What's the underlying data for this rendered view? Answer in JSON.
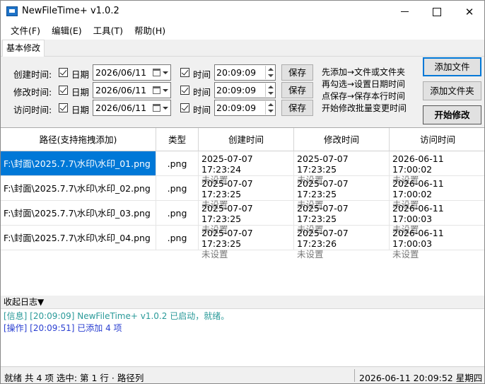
{
  "window": {
    "title": "NewFileTime+ v1.0.2"
  },
  "menu": [
    "文件(F)",
    "编辑(E)",
    "工具(T)",
    "帮助(H)"
  ],
  "tab": "基本修改",
  "rows": [
    {
      "label": "创建时间:",
      "date_check": "日期",
      "date": "2026/06/11",
      "time_check": "时间",
      "time": "20:09:09",
      "save": "保存"
    },
    {
      "label": "修改时间:",
      "date_check": "日期",
      "date": "2026/06/11",
      "time_check": "时间",
      "time": "20:09:09",
      "save": "保存"
    },
    {
      "label": "访问时间:",
      "date_check": "日期",
      "date": "2026/06/11",
      "time_check": "时间",
      "time": "20:09:09",
      "save": "保存"
    }
  ],
  "help": [
    "先添加→文件或文件夹",
    "再勾选→设置日期时间",
    "点保存→保存本行时间",
    "开始修改批量变更时间"
  ],
  "buttons": {
    "add_file": "添加文件",
    "add_folder": "添加文件夹",
    "start": "开始修改"
  },
  "table": {
    "headers": [
      "路径(支持拖拽添加)",
      "类型",
      "创建时间",
      "修改时间",
      "访问时间"
    ],
    "rows": [
      {
        "path": "F:\\封面\\2025.7.7\\水印\\水印_01.png",
        "type": ".png",
        "created": "2025-07-07 17:23:24",
        "created_new": "未设置",
        "modified": "2025-07-07 17:23:25",
        "modified_new": "未设置",
        "accessed": "2026-06-11 17:00:02",
        "accessed_new": "未设置"
      },
      {
        "path": "F:\\封面\\2025.7.7\\水印\\水印_02.png",
        "type": ".png",
        "created": "2025-07-07 17:23:25",
        "created_new": "未设置",
        "modified": "2025-07-07 17:23:25",
        "modified_new": "未设置",
        "accessed": "2026-06-11 17:00:02",
        "accessed_new": "未设置"
      },
      {
        "path": "F:\\封面\\2025.7.7\\水印\\水印_03.png",
        "type": ".png",
        "created": "2025-07-07 17:23:25",
        "created_new": "未设置",
        "modified": "2025-07-07 17:23:25",
        "modified_new": "未设置",
        "accessed": "2026-06-11 17:00:03",
        "accessed_new": "未设置"
      },
      {
        "path": "F:\\封面\\2025.7.7\\水印\\水印_04.png",
        "type": ".png",
        "created": "2025-07-07 17:23:25",
        "created_new": "未设置",
        "modified": "2025-07-07 17:23:26",
        "modified_new": "未设置",
        "accessed": "2026-06-11 17:00:03",
        "accessed_new": "未设置"
      }
    ]
  },
  "log": {
    "toggle": "收起日志▼",
    "lines": [
      "[信息] [20:09:09] NewFileTime+ v1.0.2 已启动，就绪。",
      "[操作] [20:09:51] 已添加 4 项"
    ]
  },
  "status": {
    "left": "就绪 共 4 项 选中: 第 1 行 · 路径列",
    "right": "2026-06-11 20:09:52 星期四"
  },
  "colors": {
    "selection": "#0078d7",
    "log_info": "#2a9a99",
    "log_op": "#2a3fd1"
  }
}
